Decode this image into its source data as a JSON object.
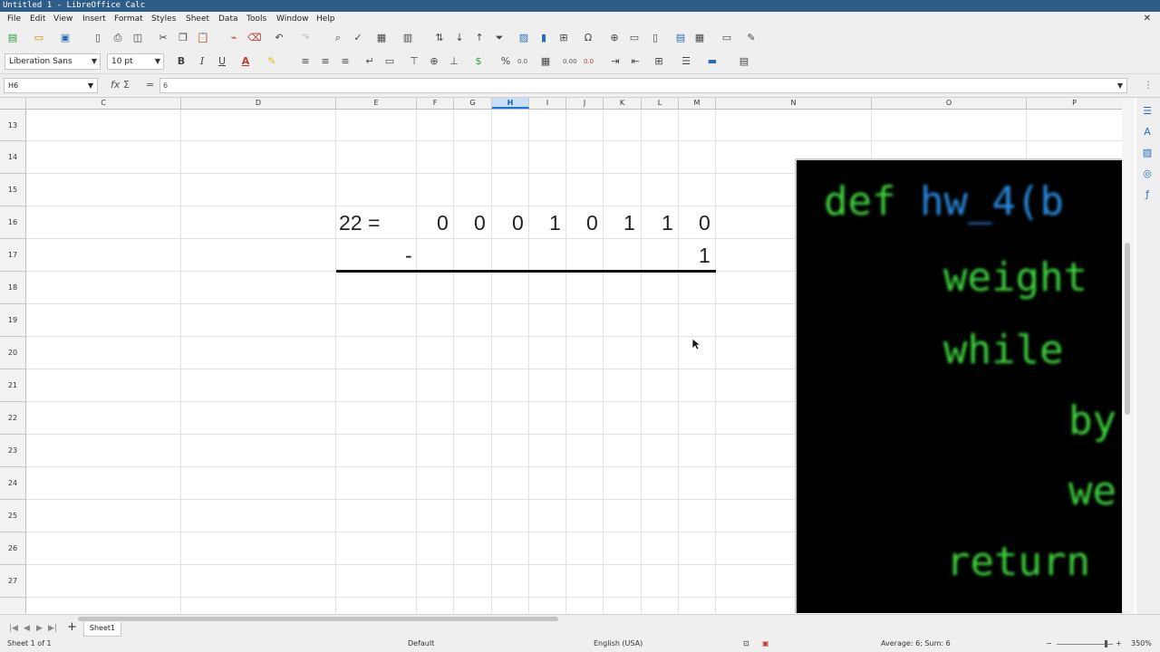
{
  "window": {
    "title": "Untitled 1 - LibreOffice Calc"
  },
  "menu": {
    "items": [
      "File",
      "Edit",
      "View",
      "Insert",
      "Format",
      "Styles",
      "Sheet",
      "Data",
      "Tools",
      "Window",
      "Help"
    ],
    "close_glyph": "✕"
  },
  "toolbar": {
    "font_name": "Liberation Sans",
    "font_size": "10 pt",
    "bold": "B",
    "italic": "I",
    "underline": "U",
    "font_color_glyph": "A",
    "percent": "%",
    "number_format": "0.0",
    "add_decimal": "0.00",
    "del_decimal": "0.0"
  },
  "formula_bar": {
    "name_box": "H6",
    "fx": "fx",
    "sum": "Σ",
    "equals": "=",
    "content": "6"
  },
  "columns": [
    "C",
    "D",
    "E",
    "F",
    "G",
    "H",
    "I",
    "J",
    "K",
    "L",
    "M",
    "N",
    "O",
    "P"
  ],
  "selected_column": "H",
  "rows": [
    "13",
    "14",
    "15",
    "16",
    "17",
    "18",
    "19",
    "20",
    "21",
    "22",
    "23",
    "24",
    "25",
    "26",
    "27"
  ],
  "cells": {
    "E16": "22 =",
    "F16": "0",
    "G16": "0",
    "H16": "0",
    "I16": "1",
    "J16": "0",
    "K16": "1",
    "L16": "1",
    "M16": "0",
    "E17": "-",
    "M17": "1"
  },
  "image_code": {
    "line1_keyword": "def",
    "line1_name": "hw_4(b",
    "line2": "weight",
    "line3": "while",
    "line4": "by",
    "line5": "we",
    "line6": "return"
  },
  "sheet_tabs": [
    "Sheet1"
  ],
  "add_sheet_glyph": "+",
  "status": {
    "sheet_info": "Sheet 1 of 1",
    "page_style": "Default",
    "language": "English (USA)",
    "summary": "Average: 6; Sum: 6",
    "zoom": "350%"
  }
}
